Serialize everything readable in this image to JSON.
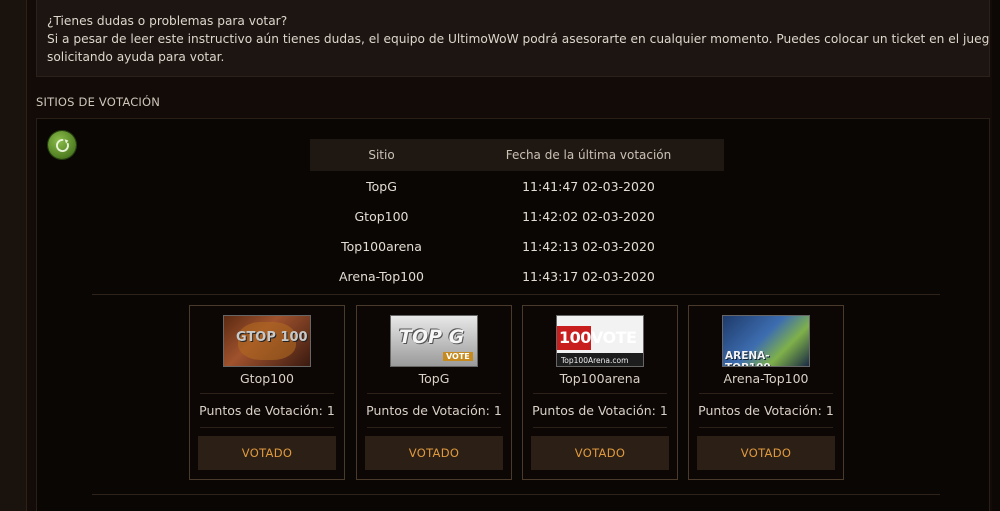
{
  "info": {
    "question": "¿Tienes dudas o problemas para votar?",
    "body_line1": "Si a pesar de leer este instructivo aún tienes dudas, el equipo de UltimoWoW podrá asesorarte en cualquier momento. Puedes colocar un ticket en el juego",
    "body_line2": "solicitando ayuda para votar."
  },
  "section_title": "SITIOS DE VOTACIÓN",
  "table": {
    "headers": [
      "Sitio",
      "Fecha de la última votación"
    ],
    "rows": [
      {
        "site": "TopG",
        "date": "11:41:47 02-03-2020"
      },
      {
        "site": "Gtop100",
        "date": "11:42:02 02-03-2020"
      },
      {
        "site": "Top100arena",
        "date": "11:42:13 02-03-2020"
      },
      {
        "site": "Arena-Top100",
        "date": "11:43:17 02-03-2020"
      }
    ]
  },
  "cards": [
    {
      "name": "Gtop100",
      "points": "Puntos de Votación: 1",
      "button": "VOTADO",
      "logo_text": "GTOP 100"
    },
    {
      "name": "TopG",
      "points": "Puntos de Votación: 1",
      "button": "VOTADO",
      "logo_text": "TOP G",
      "logo_sub": "VOTE"
    },
    {
      "name": "Top100arena",
      "points": "Puntos de Votación: 1",
      "button": "VOTADO",
      "logo_text": "100VOTE",
      "logo_sub": "Top100Arena.com"
    },
    {
      "name": "Arena-Top100",
      "points": "Puntos de Votación: 1",
      "button": "VOTADO",
      "logo_text": "ARENA-TOP100"
    }
  ],
  "icons": {
    "refresh": "refresh-icon"
  },
  "colors": {
    "background": "#120b07",
    "button_text": "#e09a3e",
    "refresh": "#6a9a35"
  }
}
